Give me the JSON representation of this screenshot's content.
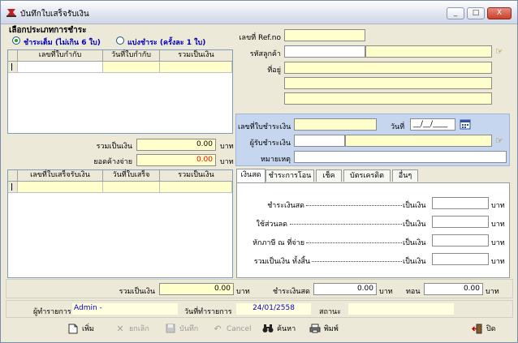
{
  "window": {
    "title": "บันทึกใบเสร็จรับเงิน",
    "controls": {
      "minimize": "_",
      "maximize": "□",
      "close": "X"
    }
  },
  "payment_type": {
    "heading": "เลือกประเภทการชำระ",
    "option_full": "ชำระเต็ม (ไม่เกิน 6 ใบ)",
    "option_partial": "แบ่งชำระ (ครั้งละ 1 ใบ)",
    "selected": "full"
  },
  "invoice_grid": {
    "columns": [
      "เลขที่ใบกำกับ",
      "วันที่ใบกำกับ",
      "รวมเป็นเงิน"
    ],
    "rows": [
      [
        "",
        "",
        ""
      ]
    ]
  },
  "totals_left": {
    "total_label": "รวมเป็นเงิน",
    "total_value": "0.00",
    "outstanding_label": "ยอดค้างจ่าย",
    "outstanding_value": "0.00",
    "unit": "บาท"
  },
  "receipt_grid": {
    "columns": [
      "เลขที่ใบเสร็จรับเงิน",
      "วันที่ใบเสร็จ",
      "รวมเป็นเงิน"
    ],
    "rows": [
      [
        "",
        "",
        ""
      ]
    ]
  },
  "customer": {
    "ref_label": "เลขที่ Ref.no",
    "ref_value": "",
    "code_label": "รหัสลูกค้า",
    "code_value": "",
    "name_value": "",
    "address_label": "ที่อยู่",
    "address_lines": [
      "",
      "",
      ""
    ]
  },
  "payment_doc": {
    "doc_no_label": "เลขที่ใบชำระเงิน",
    "doc_no_value": "",
    "date_label": "วันที่",
    "date_value": "__/__/____",
    "payer_label": "ผู้รับชำระเงิน",
    "payer_code": "",
    "payer_name": "",
    "note_label": "หมายเหตุ",
    "note_value": ""
  },
  "tabs": [
    {
      "label": "เงินสด",
      "active": true
    },
    {
      "label": "ชำระการโอน",
      "active": false
    },
    {
      "label": "เช็ค",
      "active": false
    },
    {
      "label": "บัตรเครดิต",
      "active": false
    },
    {
      "label": "อื่นๆ",
      "active": false
    }
  ],
  "cash_tab": {
    "rows": [
      {
        "label": "ชำระเงินสด",
        "suffix": "เป็นเงิน",
        "value": "",
        "unit": "บาท"
      },
      {
        "label": "ใช้ส่วนลด",
        "suffix": "เป็นเงิน",
        "value": "",
        "unit": "บาท"
      },
      {
        "label": "หักภาษี ณ ที่จ่าย",
        "suffix": "เป็นเงิน",
        "value": "",
        "unit": "บาท"
      },
      {
        "label": "รวมเป็นเงิน ทั้งสิ้น",
        "suffix": "เป็นเงิน",
        "value": "",
        "unit": "บาท"
      }
    ]
  },
  "summary": {
    "total_label": "รวมเป็นเงิน",
    "total_value": "0.00",
    "cash_label": "ชำระเงินสด",
    "cash_value": "0.00",
    "change_label": "ทอน",
    "change_value": "0.00",
    "unit": "บาท"
  },
  "status": {
    "user_label": "ผู้ทำรายการ",
    "user_value": "Admin -",
    "date_label": "วันที่ทำรายการ",
    "date_value": "24/01/2558",
    "state_label": "สถานะ",
    "state_value": ""
  },
  "toolbar": {
    "add": "เพิ่ม",
    "cancel_edit": "ยกเลิก",
    "save": "บันทึก",
    "cancel": "Cancel",
    "search": "ค้นหา",
    "print": "พิมพ์",
    "close": "ปิด"
  },
  "colors": {
    "field_yellow": "#ffffcc",
    "outstanding_red": "#ff0000",
    "panel_blue": "#c6d6ef",
    "radio_green": "#21a121",
    "heading_blue": "#0000c0"
  }
}
